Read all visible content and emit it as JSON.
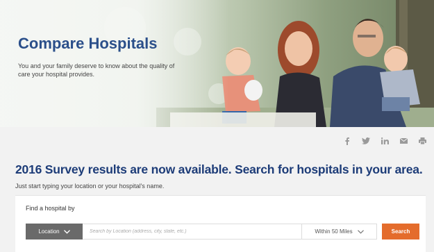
{
  "hero": {
    "title": "Compare Hospitals",
    "subtitle": "You and your family deserve to know about the quality of care your hospital provides."
  },
  "social": {
    "icons": [
      "facebook-icon",
      "twitter-icon",
      "linkedin-icon",
      "email-icon",
      "print-icon"
    ],
    "color": "#9a9a9a"
  },
  "main": {
    "headline": "2016 Survey results are now available. Search for hospitals in your area.",
    "subline": "Just start typing your location or your hospital's name."
  },
  "search": {
    "label": "Find a hospital by",
    "location_button": "Location",
    "placeholder": "Search by Location (address, city, state, etc.)",
    "radius": "Within 50 Miles",
    "submit": "Search"
  },
  "colors": {
    "brand_blue": "#1d3c78",
    "accent_orange": "#e46c2c",
    "location_gray": "#6a6a6a"
  }
}
